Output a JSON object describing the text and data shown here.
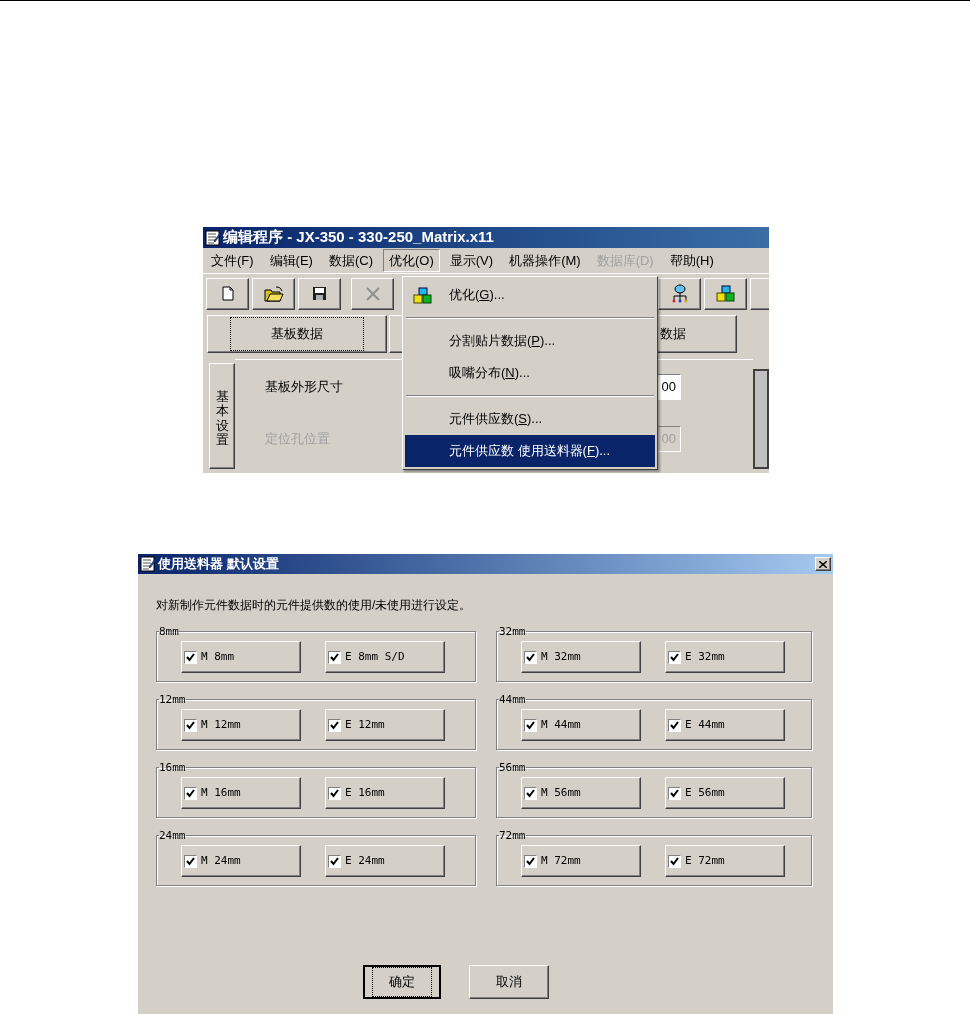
{
  "editor_window": {
    "title": "编辑程序 - JX-350 - 330-250_Matrix.x11",
    "menu": [
      {
        "label": "文件(F)",
        "selected": false,
        "disabled": false
      },
      {
        "label": "编辑(E)",
        "selected": false,
        "disabled": false
      },
      {
        "label": "数据(C)",
        "selected": false,
        "disabled": false
      },
      {
        "label": "优化(O)",
        "selected": true,
        "disabled": false
      },
      {
        "label": "显示(V)",
        "selected": false,
        "disabled": false
      },
      {
        "label": "机器操作(M)",
        "selected": false,
        "disabled": false
      },
      {
        "label": "数据库(D)",
        "selected": false,
        "disabled": true
      },
      {
        "label": "帮助(H)",
        "selected": false,
        "disabled": false
      }
    ],
    "toolbar_left": [
      {
        "kind": "new"
      },
      {
        "kind": "open"
      },
      {
        "kind": "save"
      },
      {
        "kind": "cut"
      }
    ],
    "toolbar_right": [
      {
        "kind": "tree"
      },
      {
        "kind": "cubes"
      },
      {
        "kind": "blank"
      }
    ],
    "tabs": [
      {
        "label": "基板数据",
        "selected": true
      },
      {
        "label": "数据",
        "selected": false
      }
    ],
    "side_tab": "基本设置",
    "fields": [
      {
        "label": "基板外形尺寸",
        "value": "00",
        "disabled": false
      },
      {
        "label": "定位孔位置",
        "value": "00",
        "disabled": true
      }
    ],
    "dropdown": [
      {
        "kind": "icon_item",
        "before": "优化(",
        "key": "G",
        "after": ")...",
        "selected": false
      },
      {
        "kind": "separator"
      },
      {
        "kind": "item",
        "before": "分割贴片数据(",
        "key": "P",
        "after": ")...",
        "selected": false
      },
      {
        "kind": "item",
        "before": "吸嘴分布(",
        "key": "N",
        "after": ")...",
        "selected": false
      },
      {
        "kind": "separator"
      },
      {
        "kind": "item",
        "before": "元件供应数(",
        "key": "S",
        "after": ")...",
        "selected": false
      },
      {
        "kind": "item",
        "before": "元件供应数 使用送料器(",
        "key": "F",
        "after": ")...",
        "selected": true
      }
    ]
  },
  "dialog": {
    "title": "使用送料器 默认设置",
    "description": "对新制作元件数据时的元件提供数的使用/未使用进行设定。",
    "groups": [
      {
        "title": "8mm",
        "options": [
          {
            "label": "M 8mm",
            "checked": true
          },
          {
            "label": "E 8mm S/D",
            "checked": true
          }
        ]
      },
      {
        "title": "12mm",
        "options": [
          {
            "label": "M 12mm",
            "checked": true
          },
          {
            "label": "E 12mm",
            "checked": true
          }
        ]
      },
      {
        "title": "16mm",
        "options": [
          {
            "label": "M 16mm",
            "checked": true
          },
          {
            "label": "E 16mm",
            "checked": true
          }
        ]
      },
      {
        "title": "24mm",
        "options": [
          {
            "label": "M 24mm",
            "checked": true
          },
          {
            "label": "E 24mm",
            "checked": true
          }
        ]
      },
      {
        "title": "32mm",
        "options": [
          {
            "label": "M 32mm",
            "checked": true
          },
          {
            "label": "E 32mm",
            "checked": true
          }
        ]
      },
      {
        "title": "44mm",
        "options": [
          {
            "label": "M 44mm",
            "checked": true
          },
          {
            "label": "E 44mm",
            "checked": true
          }
        ]
      },
      {
        "title": "56mm",
        "options": [
          {
            "label": "M 56mm",
            "checked": true
          },
          {
            "label": "E 56mm",
            "checked": true
          }
        ]
      },
      {
        "title": "72mm",
        "options": [
          {
            "label": "M 72mm",
            "checked": true
          },
          {
            "label": "E 72mm",
            "checked": true
          }
        ]
      }
    ],
    "buttons": [
      {
        "label": "确定",
        "default": true
      },
      {
        "label": "取消",
        "default": false
      }
    ]
  }
}
